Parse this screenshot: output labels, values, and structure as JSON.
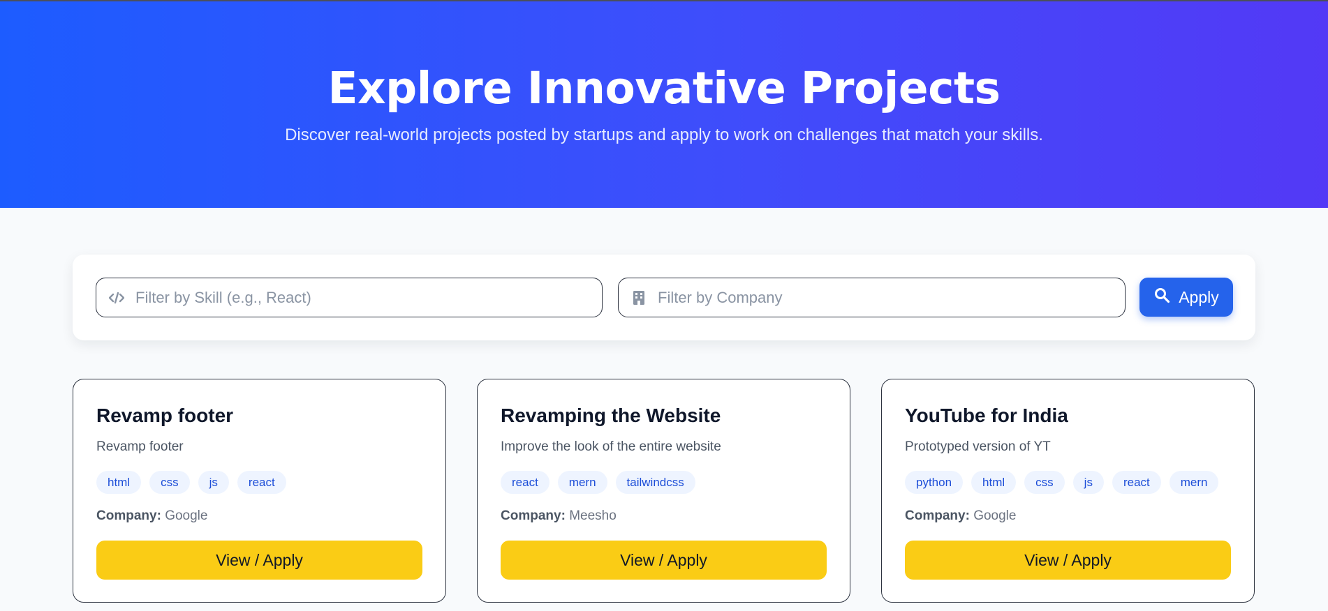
{
  "hero": {
    "title": "Explore Innovative Projects",
    "subtitle": "Discover real-world projects posted by startups and apply to work on challenges that match your skills."
  },
  "filters": {
    "skill_placeholder": "Filter by Skill (e.g., React)",
    "skill_icon": "code-icon",
    "company_placeholder": "Filter by Company",
    "company_icon": "building-icon",
    "apply_label": "Apply",
    "apply_icon": "search-icon"
  },
  "colors": {
    "hero_gradient_start": "#1d5cff",
    "hero_gradient_end": "#5339f6",
    "primary": "#2563eb",
    "cta_yellow": "#facc15",
    "tag_bg": "#eef4ff",
    "tag_text": "#1d4ed8"
  },
  "company_label": "Company:",
  "projects": [
    {
      "title": "Revamp footer",
      "description": "Revamp footer",
      "tags": [
        "html",
        "css",
        "js",
        "react"
      ],
      "company": "Google",
      "button_label": "View / Apply"
    },
    {
      "title": "Revamping the Website",
      "description": "Improve the look of the entire website",
      "tags": [
        "react",
        "mern",
        "tailwindcss"
      ],
      "company": "Meesho",
      "button_label": "View / Apply"
    },
    {
      "title": "YouTube for India",
      "description": "Prototyped version of YT",
      "tags": [
        "python",
        "html",
        "css",
        "js",
        "react",
        "mern"
      ],
      "company": "Google",
      "button_label": "View / Apply"
    }
  ]
}
